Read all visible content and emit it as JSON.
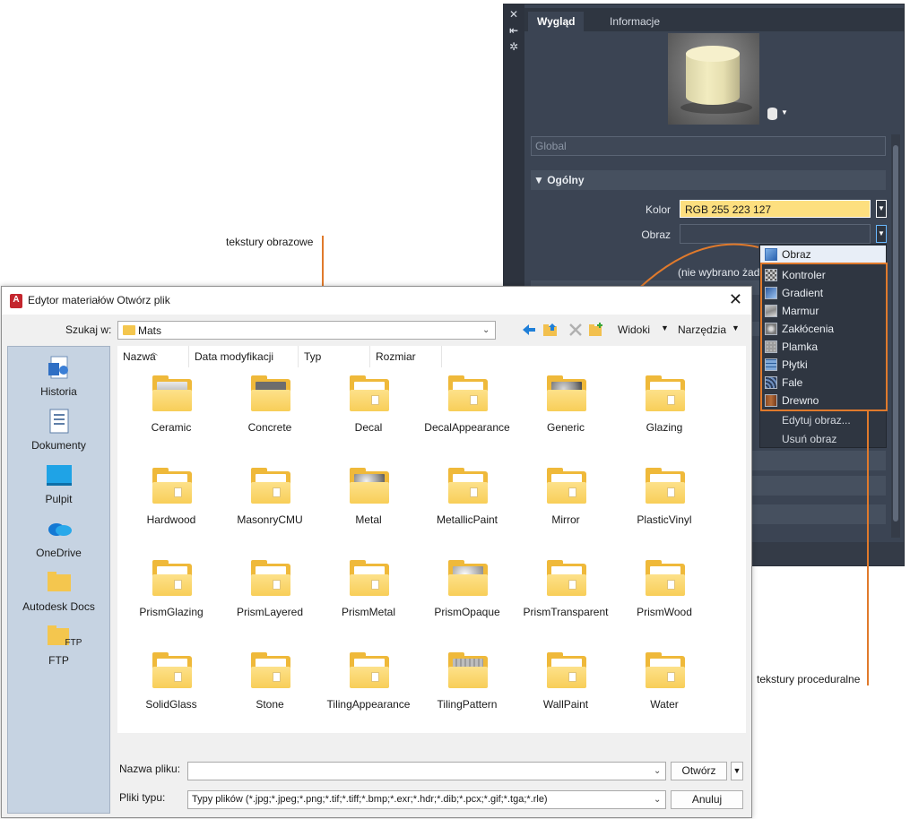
{
  "palette": {
    "strip_icons": [
      "close-icon",
      "pin-icon",
      "settings-icon"
    ],
    "tabs": [
      {
        "label": "Wygląd",
        "active": true
      },
      {
        "label": "Informacje",
        "active": false
      }
    ],
    "global_placeholder": "Global",
    "section_general": "Ogólny",
    "color_label": "Kolor",
    "color_value": "RGB 255 223 127",
    "image_label": "Obraz",
    "no_image_text": "(nie wybrano żad",
    "accent_color": "#fddf7f"
  },
  "image_menu": {
    "header": "Obraz",
    "items": [
      "Kontroler",
      "Gradient",
      "Marmur",
      "Zakłócenia",
      "Plamka",
      "Płytki",
      "Fale",
      "Drewno"
    ],
    "actions": [
      "Edytuj obraz...",
      "Usuń obraz"
    ]
  },
  "callouts": {
    "image_textures": "tekstury obrazowe",
    "procedural_textures": "tekstury proceduralne",
    "highlight_color": "#e07a2c"
  },
  "dialog": {
    "title": "Edytor materiałów Otwórz plik",
    "look_in_label": "Szukaj w:",
    "look_in_value": "Mats",
    "views_label": "Widoki",
    "tools_label": "Narzędzia",
    "places": [
      "Historia",
      "Dokumenty",
      "Pulpit",
      "OneDrive",
      "Autodesk Docs",
      "FTP"
    ],
    "ftp_overlay": "FTP",
    "columns": [
      "Nazwa",
      "Data modyfikacji",
      "Typ",
      "Rozmiar"
    ],
    "folders": [
      "Ceramic",
      "Concrete",
      "Decal",
      "DecalAppearance",
      "Generic",
      "Glazing",
      "Hardwood",
      "MasonryCMU",
      "Metal",
      "MetallicPaint",
      "Mirror",
      "PlasticVinyl",
      "PrismGlazing",
      "PrismLayered",
      "PrismMetal",
      "PrismOpaque",
      "PrismTransparent",
      "PrismWood",
      "SolidGlass",
      "Stone",
      "TilingAppearance",
      "TilingPattern",
      "WallPaint",
      "Water"
    ],
    "file_name_label": "Nazwa pliku:",
    "file_name_value": "",
    "file_type_label": "Pliki typu:",
    "file_type_value": "Typy plików  (*.jpg;*.jpeg;*.png;*.tif;*.tiff;*.bmp;*.exr;*.hdr;*.dib;*.pcx;*.gif;*.tga;*.rle)",
    "open_button": "Otwórz",
    "cancel_button": "Anuluj"
  }
}
